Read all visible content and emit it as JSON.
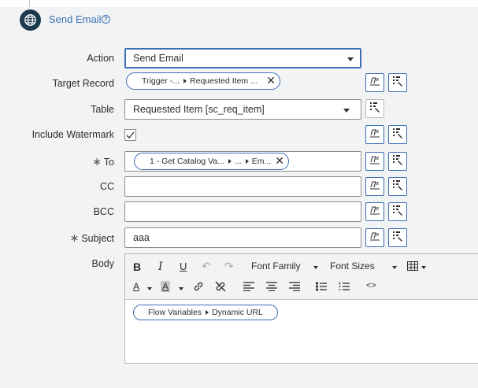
{
  "header": {
    "title": "Send Email",
    "help_icon": "?"
  },
  "form": {
    "action": {
      "label": "Action",
      "value": "Send Email"
    },
    "target_record": {
      "label": "Target Record",
      "pill_parts": [
        "Trigger -...",
        "Requested Item ..."
      ]
    },
    "table": {
      "label": "Table",
      "value": "Requested Item [sc_req_item]"
    },
    "include_watermark": {
      "label": "Include Watermark",
      "checked": true
    },
    "to": {
      "label": "To",
      "required_mark": "∗",
      "pill_parts": [
        "1 - Get Catalog Va...",
        "...",
        "Em..."
      ]
    },
    "cc": {
      "label": "CC",
      "value": ""
    },
    "bcc": {
      "label": "BCC",
      "value": ""
    },
    "subject": {
      "label": "Subject",
      "required_mark": "∗",
      "value": "aaa"
    },
    "body": {
      "label": "Body",
      "toolbar": {
        "bold": "B",
        "italic": "I",
        "underline": "U",
        "font_family": "Font Family",
        "font_sizes": "Font Sizes",
        "font_color": "A",
        "bg_color": "A",
        "source_code": "<>"
      },
      "pill_parts": [
        "Flow Variables",
        "Dynamic URL"
      ]
    }
  },
  "colors": {
    "accent": "#3d6fb6",
    "icon_bg": "#1b3a4b",
    "page_bg": "#f2f3f4"
  },
  "icons": [
    "globe-icon",
    "help-icon",
    "clear-icon",
    "data-pill-picker-icon",
    "script-icon",
    "checkmark-icon",
    "bold-icon",
    "italic-icon",
    "underline-icon",
    "undo-icon",
    "redo-icon",
    "table-icon",
    "font-color-icon",
    "background-color-icon",
    "link-icon",
    "unlink-icon",
    "align-left-icon",
    "align-center-icon",
    "align-right-icon",
    "bullet-list-icon",
    "numbered-list-icon",
    "source-code-icon"
  ]
}
